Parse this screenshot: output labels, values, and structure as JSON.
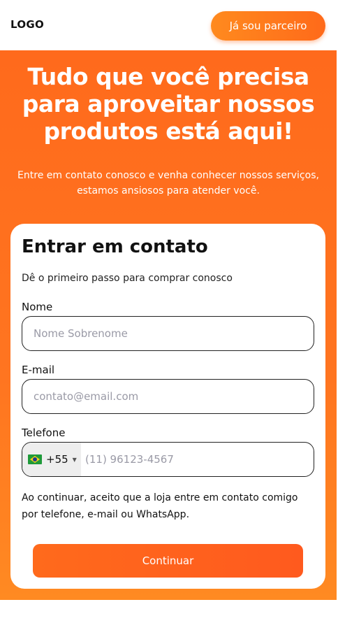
{
  "header": {
    "logo": "LOGO",
    "partner_button": "Já sou parceiro"
  },
  "hero": {
    "title": "Tudo que você precisa para aproveitar nossos produtos está aqui!",
    "subtitle": "Entre em contato conosco e venha conhecer nossos serviços, estamos ansiosos para atender você."
  },
  "form": {
    "title": "Entrar em contato",
    "description": "Dê o primeiro passo para comprar conosco",
    "name": {
      "label": "Nome",
      "placeholder": "Nome Sobrenome",
      "value": ""
    },
    "email": {
      "label": "E-mail",
      "placeholder": "contato@email.com",
      "value": ""
    },
    "phone": {
      "label": "Telefone",
      "country_code": "+55",
      "flag_icon": "brazil-flag-icon",
      "placeholder": "(11) 96123-4567",
      "value": ""
    },
    "consent": "Ao continuar, aceito que a loja entre em contato comigo por telefone, e-mail ou WhatsApp.",
    "submit": "Continuar"
  },
  "colors": {
    "brand_orange": "#ff6a1c",
    "brand_orange_light": "#ff8a22"
  }
}
